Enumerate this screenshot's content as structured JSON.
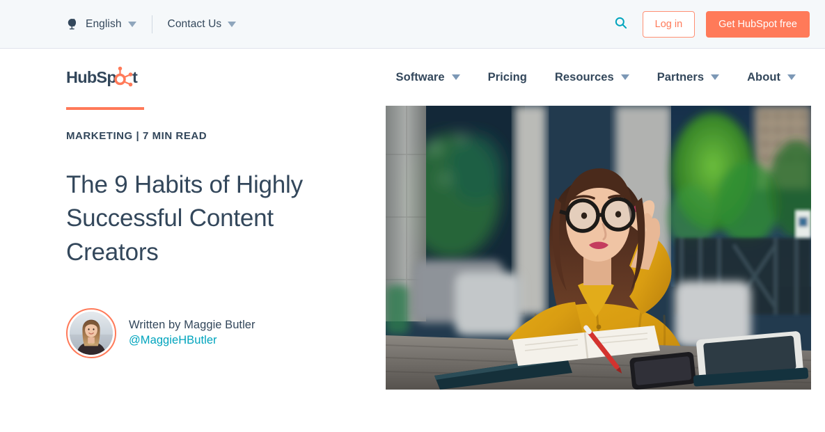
{
  "utility_bar": {
    "language": {
      "icon": "globe-icon",
      "label": "English",
      "caret": "chevron-down-icon"
    },
    "contact": {
      "label": "Contact Us",
      "caret": "chevron-down-icon"
    },
    "search": {
      "icon": "search-icon"
    },
    "login_label": "Log in",
    "cta_label": "Get HubSpot free"
  },
  "brand": {
    "logo_text_a": "HubSp",
    "logo_text_b": "t",
    "logo_name": "hubspot-logo"
  },
  "nav": {
    "items": [
      {
        "label": "Software",
        "has_caret": true
      },
      {
        "label": "Pricing",
        "has_caret": false
      },
      {
        "label": "Resources",
        "has_caret": true
      },
      {
        "label": "Partners",
        "has_caret": true
      },
      {
        "label": "About",
        "has_caret": true
      }
    ]
  },
  "article": {
    "eyebrow": "MARKETING | 7 MIN READ",
    "title": "The 9 Habits of Highly Successful Content Creators",
    "author_line": "Written by Maggie Butler",
    "author_handle": "@MaggieHButler",
    "hero_image_alt": "Woman in mustard blouse with round glasses sitting at a cafe table with notebook, phone and tablet"
  },
  "colors": {
    "brand_orange": "#ff7a59",
    "brand_navy": "#33475b",
    "brand_teal": "#00a4bd",
    "utility_bg": "#f5f8fa",
    "caret_gray": "#7c98b6"
  }
}
